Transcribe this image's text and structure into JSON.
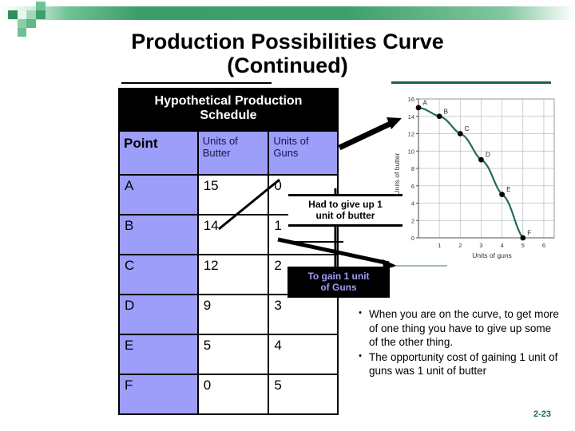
{
  "slide": {
    "title_line1": "Production Possibilities Curve",
    "title_line2": "(Continued)",
    "page_number": "2-23"
  },
  "table": {
    "caption_line1": "Hypothetical Production",
    "caption_line2": "Schedule",
    "columns": [
      "Point",
      "Units of Butter",
      "Units of Guns"
    ],
    "column_header_1": "Point",
    "column_header_2_line1": "Units of",
    "column_header_2_line2": "Butter",
    "column_header_3_line1": "Units of",
    "column_header_3_line2": "Guns",
    "rows": [
      {
        "point": "A",
        "butter": "15",
        "guns": "0"
      },
      {
        "point": "B",
        "butter": "14",
        "guns": "1"
      },
      {
        "point": "C",
        "butter": "12",
        "guns": "2"
      },
      {
        "point": "D",
        "butter": "9",
        "guns": "3"
      },
      {
        "point": "E",
        "butter": "5",
        "guns": "4"
      },
      {
        "point": "F",
        "butter": "0",
        "guns": "5"
      }
    ],
    "header_bg": "#000000",
    "cell_accent": "#9d9dfa"
  },
  "callouts": {
    "butter_line1": "Had to give up 1",
    "butter_line2": "unit of butter",
    "guns_line1": "To gain 1 unit",
    "guns_line2": "of Guns",
    "guns_text_color": "#9d9dfa",
    "guns_bg_color": "#000000"
  },
  "bullets": {
    "marker": "•",
    "items": [
      "When you are on the curve, to get more of one thing you have to give up some of the other thing.",
      "The opportunity cost of gaining 1 unit of guns was 1 unit of butter"
    ]
  },
  "chart_data": {
    "type": "line",
    "title": "",
    "xlabel": "Units of guns",
    "ylabel": "Units of butter",
    "xlim": [
      0,
      6.5
    ],
    "ylim": [
      0,
      16
    ],
    "xticks": [
      1,
      2,
      3,
      4,
      5,
      6
    ],
    "yticks": [
      0,
      2,
      4,
      6,
      8,
      10,
      12,
      14,
      16
    ],
    "grid": true,
    "legend": "none",
    "line_color": "#1f6b5e",
    "marker_color": "#000000",
    "point_labels": [
      "A",
      "B",
      "C",
      "D",
      "E",
      "F"
    ],
    "x": [
      0,
      1,
      2,
      3,
      4,
      5
    ],
    "y": [
      15,
      14,
      12,
      9,
      5,
      0
    ],
    "series": [
      {
        "name": "Production Possibilities Curve",
        "points": [
          {
            "label": "A",
            "x": 0,
            "y": 15
          },
          {
            "label": "B",
            "x": 1,
            "y": 14
          },
          {
            "label": "C",
            "x": 2,
            "y": 12
          },
          {
            "label": "D",
            "x": 3,
            "y": 9
          },
          {
            "label": "E",
            "x": 4,
            "y": 5
          },
          {
            "label": "F",
            "x": 5,
            "y": 0
          }
        ]
      }
    ]
  },
  "theme": {
    "accent_green": "#3e9f6c",
    "rule_green": "#17624a",
    "page_number_green": "#1f6b4e"
  }
}
